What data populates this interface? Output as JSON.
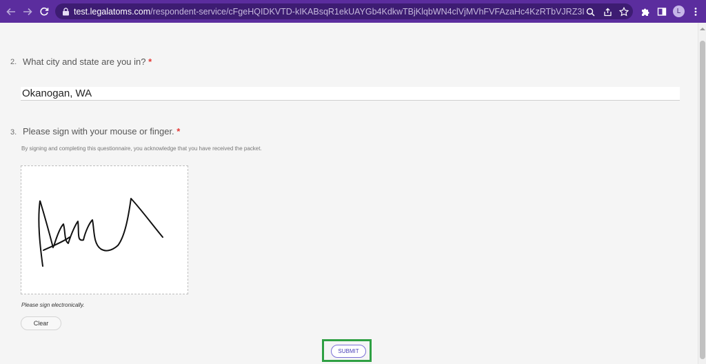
{
  "browser": {
    "url_host": "test.legalatoms.com",
    "url_path": "/respondent-service/cFgeHQIDKVTD-kIKABsqR1ekUAYGb4KdkwTBjKlqbWN4clVjMVhFVFAzaHc4KzRTbVJRZ3I0aVBGdzJzQjY3NWcvd0V5Z...",
    "profile_initial": "L",
    "icons": [
      "back-arrow-icon",
      "forward-arrow-icon",
      "reload-icon",
      "lock-icon",
      "zoom-icon",
      "share-icon",
      "bookmark-star-icon",
      "extensions-puzzle-icon",
      "side-panel-icon",
      "kebab-menu-icon"
    ]
  },
  "form": {
    "q2": {
      "number": "2.",
      "label": "What city and state are you in?",
      "required_mark": "*",
      "value": "Okanogan, WA"
    },
    "q3": {
      "number": "3.",
      "label": "Please sign with your mouse or finger.",
      "required_mark": "*",
      "helper": "By signing and completing this questionnaire, you acknowledge that you have received the packet.",
      "signature_hint": "Please sign electronically.",
      "clear_label": "Clear"
    },
    "submit_label": "SUBMIT"
  },
  "colors": {
    "chrome_bar": "#5b2d9e",
    "required_star": "#e53935",
    "submit_highlight": "#2ea043",
    "submit_text": "#4a3fb8"
  }
}
